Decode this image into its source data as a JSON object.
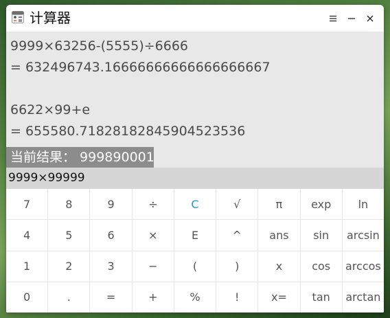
{
  "window": {
    "title": "计算器"
  },
  "display": {
    "history": [
      {
        "expression": "9999×63256-(5555)÷6666",
        "result": "= 632496743.16666666666666666667"
      },
      {
        "expression": "6622×99+e",
        "result": "= 655580.71828182845904523536"
      }
    ],
    "current_result": "当前结果： 999890001"
  },
  "input": {
    "value": "9999×99999"
  },
  "keypad": {
    "keys": [
      [
        "7",
        "8",
        "9",
        "÷",
        "C",
        "√",
        "π",
        "exp",
        "ln"
      ],
      [
        "4",
        "5",
        "6",
        "×",
        "E",
        "^",
        "ans",
        "sin",
        "arcsin"
      ],
      [
        "1",
        "2",
        "3",
        "−",
        "(",
        ")",
        "x",
        "cos",
        "arccos"
      ],
      [
        "0",
        ".",
        "=",
        "+",
        "%",
        "!",
        "x=",
        "tan",
        "arctan"
      ]
    ]
  },
  "colors": {
    "accent": "#2196d3",
    "result_bg": "#8c8c8c",
    "display_bg": "#e8e8e8",
    "input_bg": "#d6d6d6"
  },
  "icons": {
    "app": "calculator-icon",
    "menu": "hamburger-menu-icon",
    "minimize": "minimize-icon",
    "close": "close-icon"
  }
}
